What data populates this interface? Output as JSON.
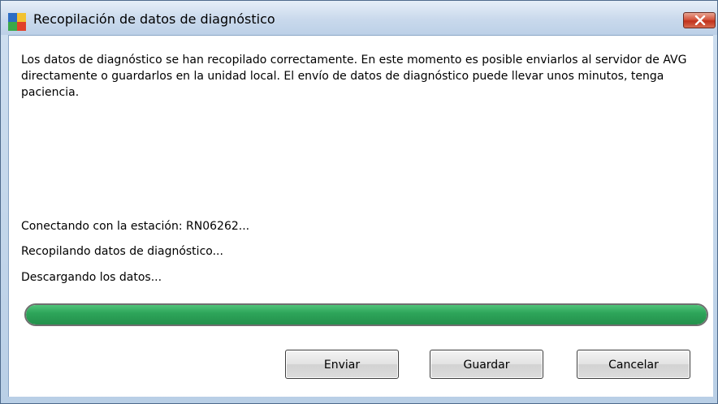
{
  "window": {
    "title": "Recopilación de datos de diagnóstico",
    "app_icon": "avg-logo-icon",
    "close_icon": "close-icon"
  },
  "main": {
    "description": "Los datos de diagnóstico se han recopilado correctamente. En este momento es posible enviarlos al servidor de AVG directamente o guardarlos en la unidad local. El envío de datos de diagnóstico puede llevar unos minutos, tenga paciencia.",
    "status_lines": [
      "Conectando con la estación: RN06262...",
      "Recopilando datos de diagnóstico...",
      "Descargando los datos..."
    ],
    "progress_percent": 100
  },
  "buttons": {
    "send": "Enviar",
    "save": "Guardar",
    "cancel": "Cancelar"
  },
  "colors": {
    "progress_fill": "#2ea55a",
    "titlebar": "#c9d9ec",
    "close_button": "#c0321b"
  }
}
